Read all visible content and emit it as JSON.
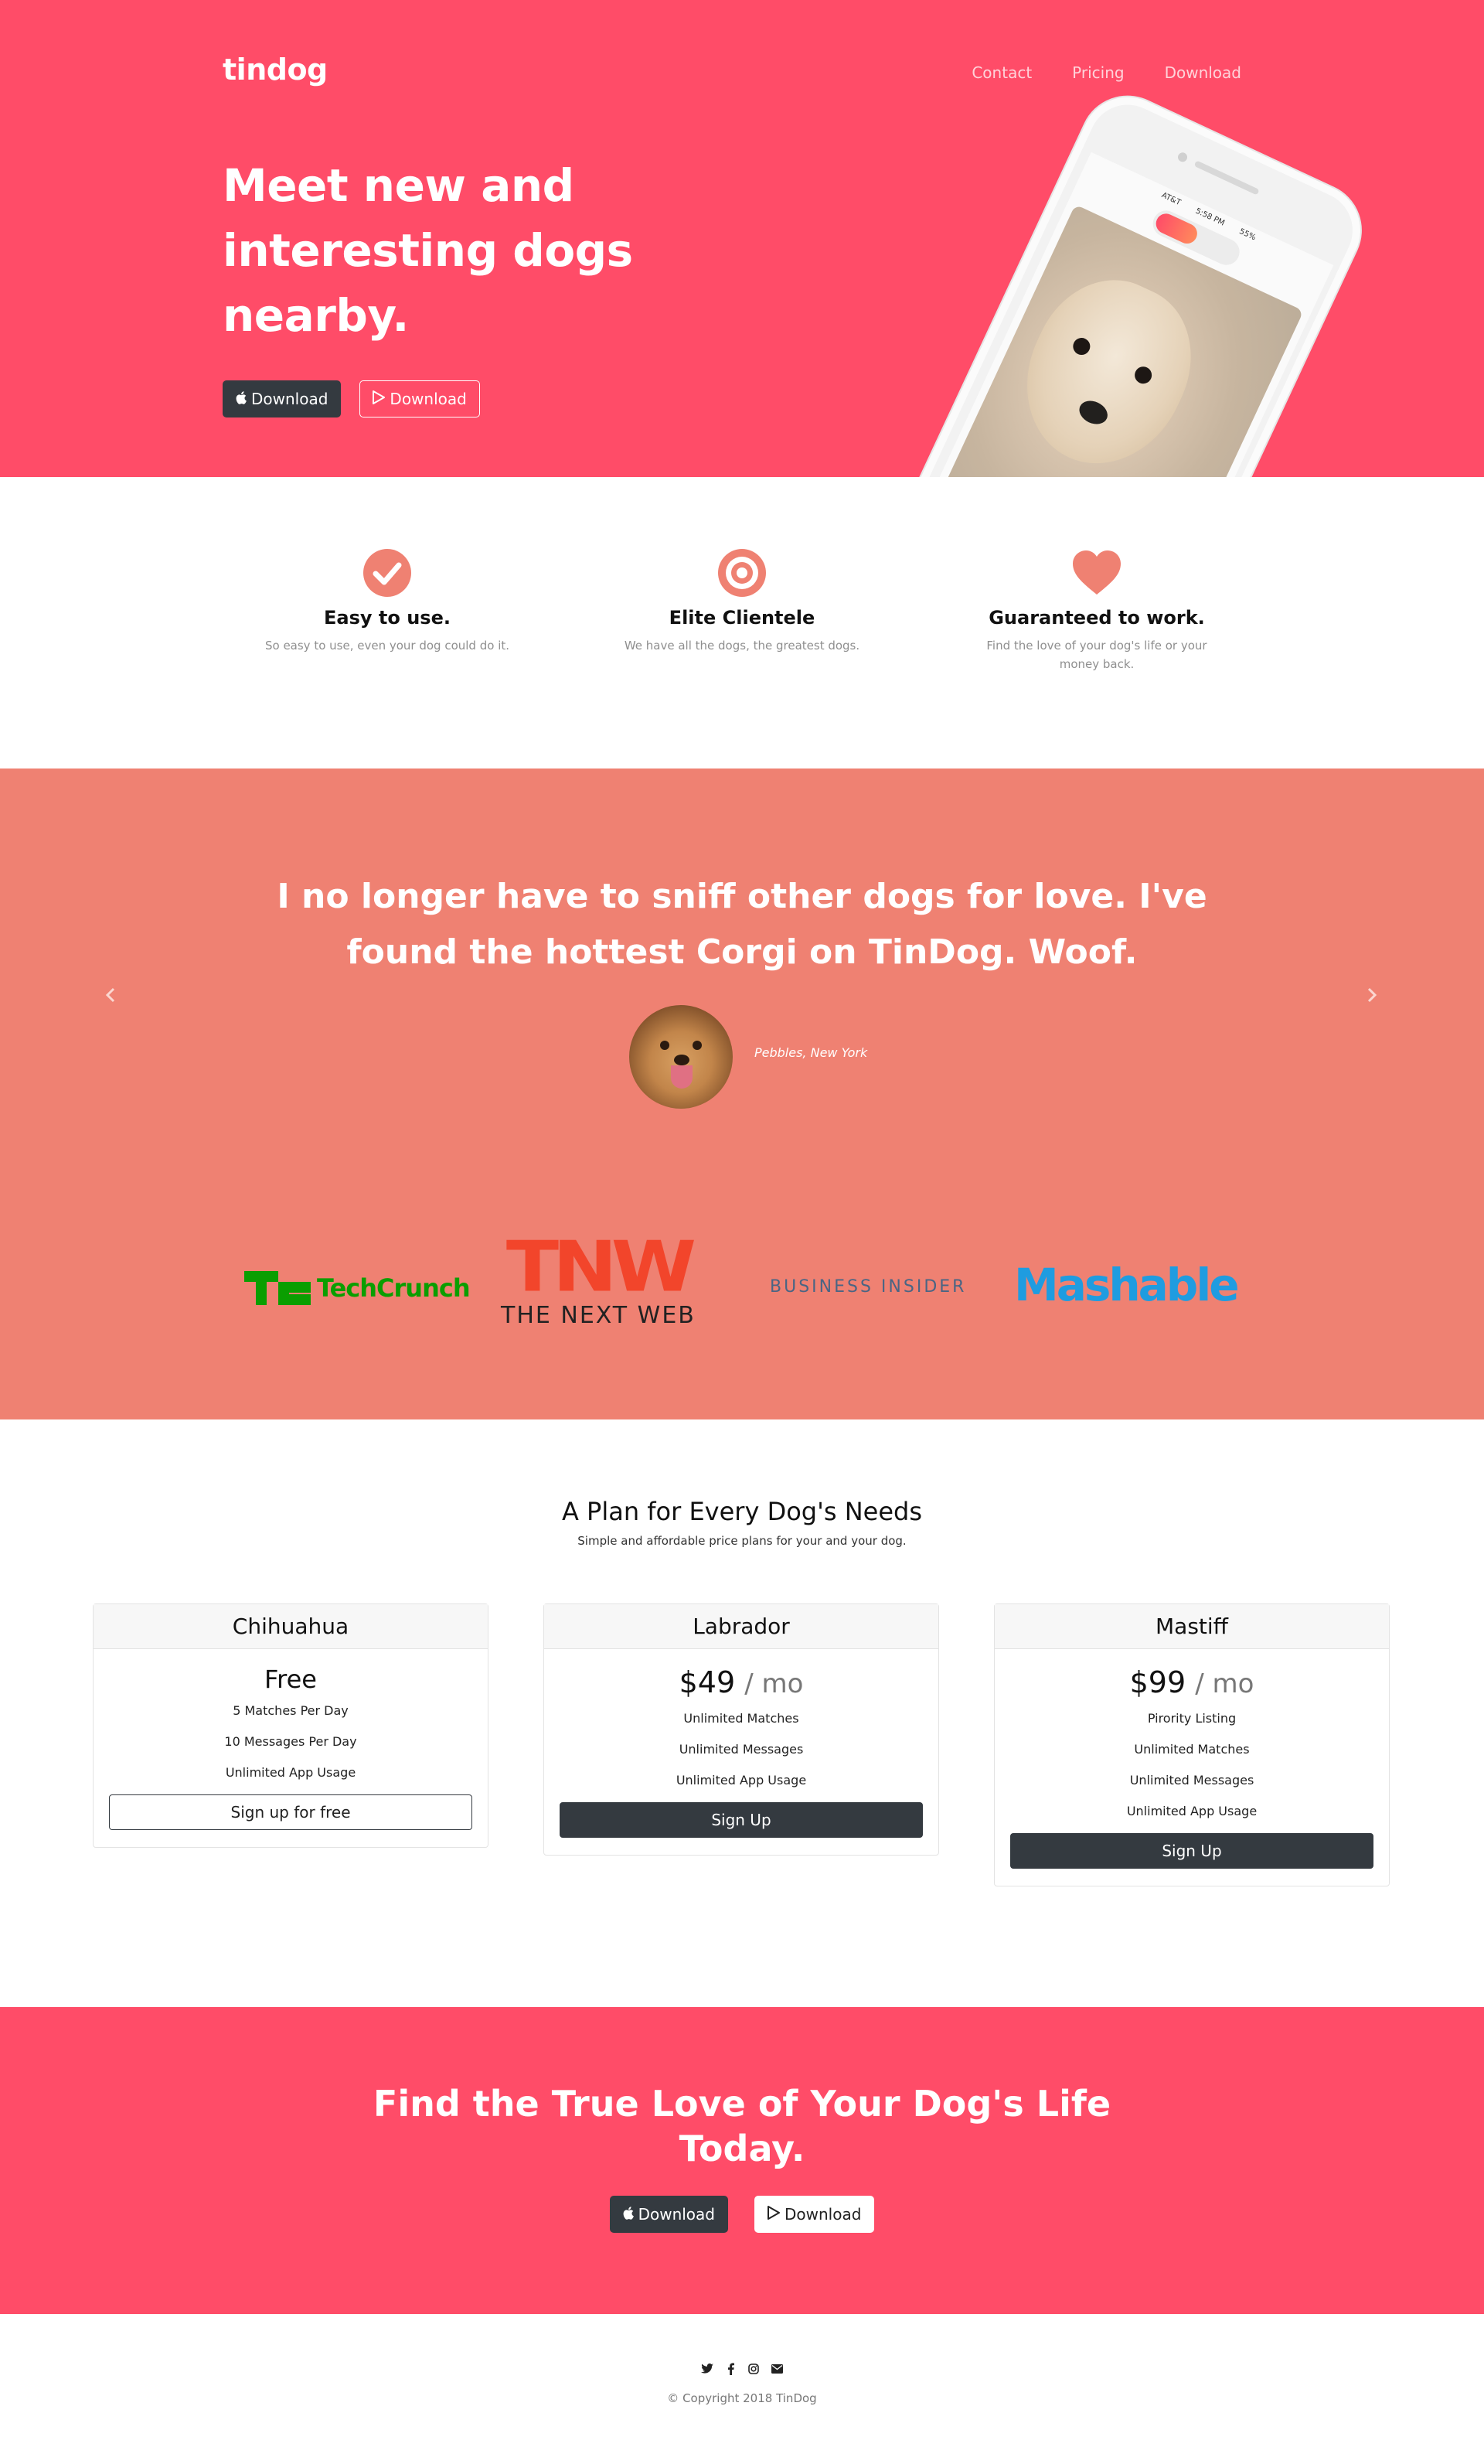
{
  "hero": {
    "brand": "tindog",
    "nav": [
      "Contact",
      "Pricing",
      "Download"
    ],
    "title": "Meet new and interesting dogs nearby.",
    "apple_button": "Download",
    "play_button": "Download",
    "phone": {
      "carrier": "AT&T",
      "time": "5:58 PM",
      "battery": "55%"
    }
  },
  "features": [
    {
      "icon": "check-circle-icon",
      "title": "Easy to use.",
      "text": "So easy to use, even your dog could do it."
    },
    {
      "icon": "bullseye-icon",
      "title": "Elite Clientele",
      "text": "We have all the dogs, the greatest dogs."
    },
    {
      "icon": "heart-icon",
      "title": "Guaranteed to work.",
      "text": "Find the love of your dog's life or your money back."
    }
  ],
  "testimonial": {
    "quote": "I no longer have to sniff other dogs for love. I've found the hottest Corgi on TinDog. Woof.",
    "attribution": "Pebbles, New York"
  },
  "press": {
    "techcrunch": "TechCrunch",
    "tnw_mark": "TNW",
    "tnw_name": "THE NEXT WEB",
    "business_insider": "BUSINESS INSIDER",
    "mashable": "Mashable"
  },
  "pricing": {
    "title": "A Plan for Every Dog's Needs",
    "subtitle": "Simple and affordable price plans for your and your dog.",
    "plans": [
      {
        "name": "Chihuahua",
        "price": "Free",
        "per": "",
        "features": [
          "5 Matches Per Day",
          "10 Messages Per Day",
          "Unlimited App Usage"
        ],
        "cta": "Sign up for free"
      },
      {
        "name": "Labrador",
        "price": "$49",
        "per": "/ mo",
        "features": [
          "Unlimited Matches",
          "Unlimited Messages",
          "Unlimited App Usage"
        ],
        "cta": "Sign Up"
      },
      {
        "name": "Mastiff",
        "price": "$99",
        "per": "/ mo",
        "features": [
          "Pirority Listing",
          "Unlimited Matches",
          "Unlimited Messages",
          "Unlimited App Usage"
        ],
        "cta": "Sign Up"
      }
    ]
  },
  "cta": {
    "title": "Find the True Love of Your Dog's Life Today.",
    "apple_button": "Download",
    "play_button": "Download"
  },
  "footer": {
    "social": [
      "twitter-icon",
      "facebook-icon",
      "instagram-icon",
      "envelope-icon"
    ],
    "copyright": "© Copyright 2018 TinDog"
  },
  "colors": {
    "hero_bg": "#ff4c68",
    "testimonial_bg": "#ef8172",
    "dark_button": "#343a40",
    "icon_accent": "#ef8172"
  }
}
